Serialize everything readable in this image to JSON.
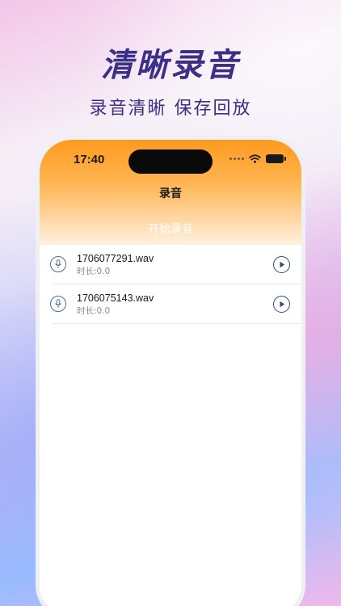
{
  "promo": {
    "headline": "清晰录音",
    "subline": "录音清晰 保存回放"
  },
  "status_bar": {
    "time": "17:40"
  },
  "header": {
    "title": "录音",
    "start_label": "开始录音"
  },
  "recordings": [
    {
      "file_name": "1706077291.wav",
      "duration": "时长:0.0"
    },
    {
      "file_name": "1706075143.wav",
      "duration": "时长:0.0"
    }
  ],
  "colors": {
    "headline": "#3b2f86",
    "header_top": "#ff9a1f",
    "icon_stroke": "#2f4a66"
  },
  "icons": {
    "row_left": "microphone-icon",
    "row_right": "play-icon",
    "status": [
      "signal-dots-icon",
      "wifi-icon",
      "battery-icon"
    ]
  }
}
